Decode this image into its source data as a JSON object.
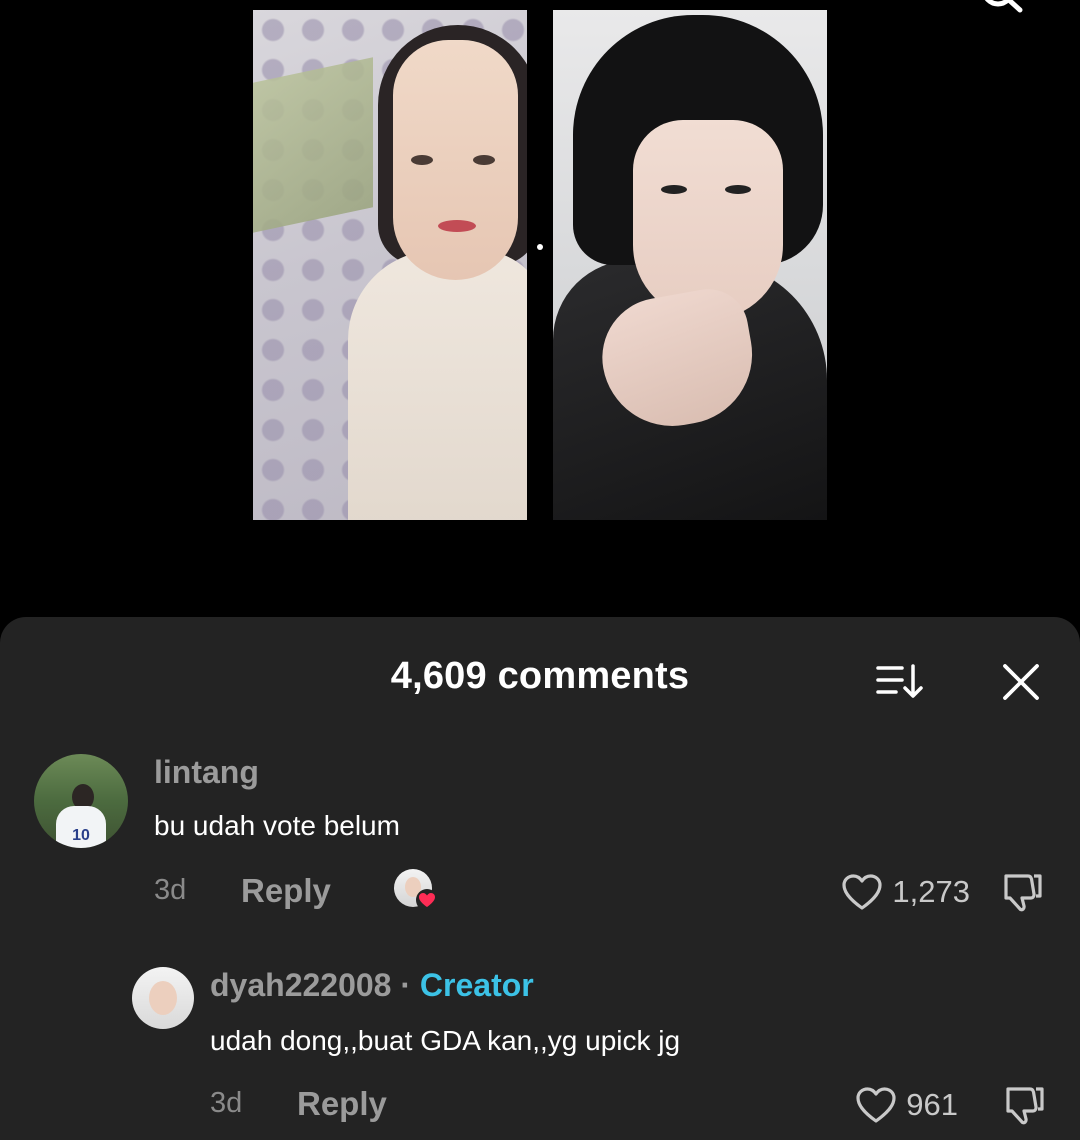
{
  "comments_sheet": {
    "title": "4,609 comments"
  },
  "comments": [
    {
      "username": "lintang",
      "avatar_jersey_number": "10",
      "text": "bu udah vote belum",
      "time": "3d",
      "reply_label": "Reply",
      "likes": "1,273",
      "liked_by_creator": true
    },
    {
      "username": "dyah222008",
      "separator": "·",
      "tag": "Creator",
      "text": "udah dong,,buat GDA kan,,yg upick jg",
      "time": "3d",
      "reply_label": "Reply",
      "likes": "961"
    }
  ],
  "colors": {
    "sheet_background": "#232323",
    "creator_tag": "#3cc2e6",
    "like_badge": "#fe2c55"
  },
  "icons": [
    "search-icon",
    "sort-icon",
    "close-icon",
    "heart-icon",
    "dislike-icon"
  ]
}
